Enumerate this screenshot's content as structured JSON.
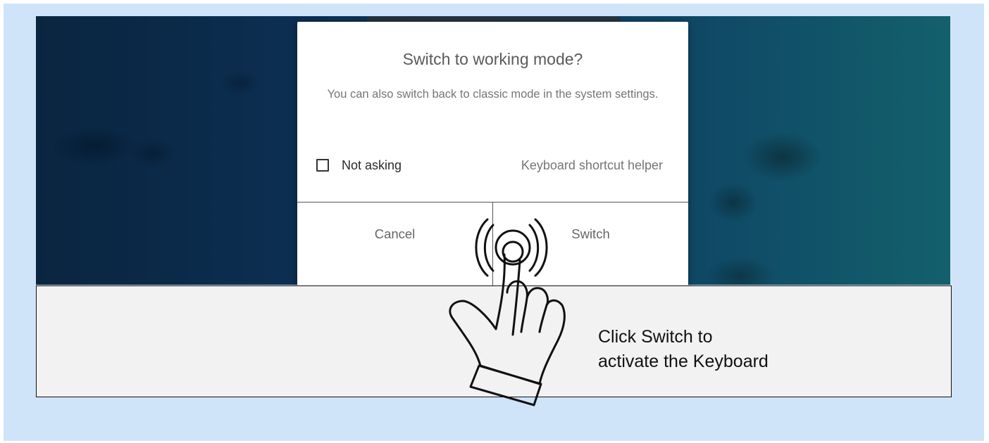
{
  "dialog": {
    "title": "Switch to working mode?",
    "message": "You can also switch back to classic mode in the system settings.",
    "checkbox_label": "Not asking",
    "checkbox_checked": false,
    "keyboard_helper_label": "Keyboard shortcut helper",
    "cancel_label": "Cancel",
    "switch_label": "Switch"
  },
  "caption": {
    "line1": "Click Switch to",
    "line2": "activate the Keyboard"
  },
  "colors": {
    "page_background": "#cfe4f8",
    "caption_background": "#f2f2f2",
    "dialog_background": "#ffffff"
  },
  "icons": {
    "tap_hand": "hand-tap-icon"
  }
}
